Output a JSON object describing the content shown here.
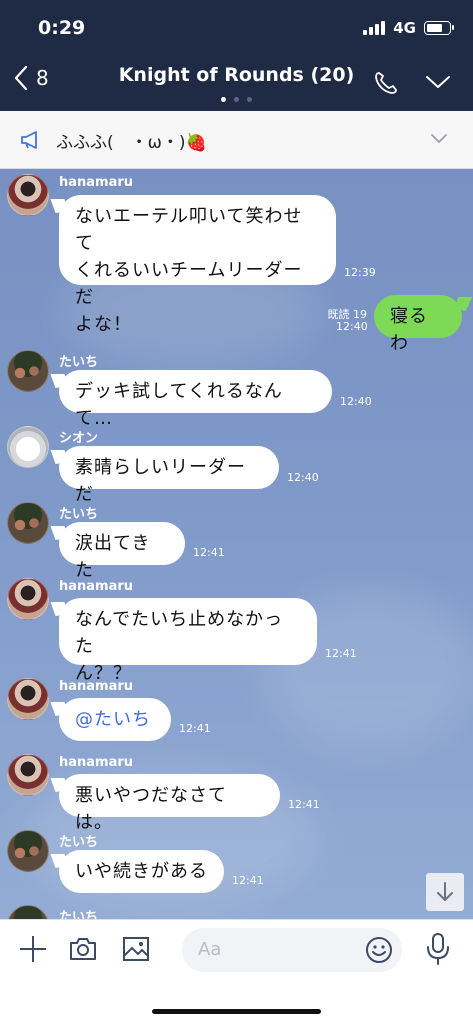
{
  "status_bar": {
    "time": "0:29",
    "network": "4G"
  },
  "header": {
    "back_count": "8",
    "title": "Knight of Rounds (20)"
  },
  "announcement": {
    "text": "ふふふ(　・ω・)🍓"
  },
  "messages": [
    {
      "sender": "hanamaru",
      "text": "ないエーテル叩いて笑わせて\nくれるいいチームリーダーだ\nよな！",
      "time": "12:39"
    },
    {
      "sender": "me",
      "text": "寝るわ",
      "read": "既読 19",
      "time": "12:40"
    },
    {
      "sender": "たいち",
      "text": "デッキ試してくれるなんて…",
      "time": "12:40"
    },
    {
      "sender": "シオン",
      "text": "素晴らしいリーダーだ",
      "time": "12:40"
    },
    {
      "sender": "たいち",
      "text": "涙出てきた",
      "time": "12:41"
    },
    {
      "sender": "hanamaru",
      "text": "なんでたいち止めなかった\nん？？",
      "time": "12:41"
    },
    {
      "sender": "hanamaru",
      "text": "@たいち",
      "time": "12:41"
    },
    {
      "sender": "hanamaru",
      "text": "悪いやつだなさては。",
      "time": "12:41"
    },
    {
      "sender": "たいち",
      "text": "いや続きがある",
      "time": "12:41"
    },
    {
      "sender": "たいち",
      "text": "",
      "time": ""
    }
  ],
  "input": {
    "placeholder": "Aa"
  },
  "colors": {
    "header_bg": "#1f2a44",
    "my_bubble": "#7ed957",
    "chat_bg": "#7f99c9"
  }
}
